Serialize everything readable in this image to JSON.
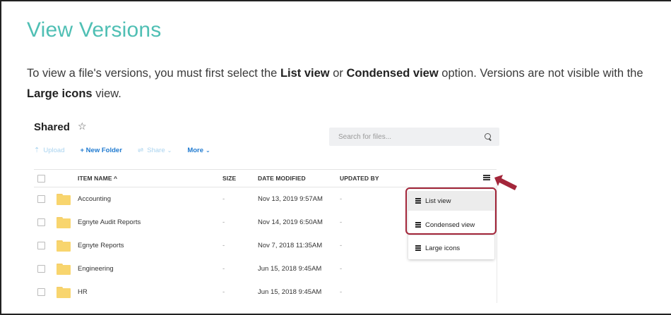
{
  "doc": {
    "title": "View Versions",
    "para_1": "To view a file's versions, you must first select the ",
    "para_bold_1": "List view",
    "para_2": " or ",
    "para_bold_2": "Condensed view",
    "para_3": " option. Versions are not visible with the ",
    "para_bold_3": "Large icons",
    "para_4": " view."
  },
  "app": {
    "folder_title": "Shared",
    "star_icon": "star-outline-icon",
    "toolbar": {
      "upload": "Upload",
      "new_folder": "+ New Folder",
      "share": "Share",
      "more": "More"
    },
    "search": {
      "placeholder": "Search for files..."
    },
    "table": {
      "headers": {
        "name": "ITEM NAME ^",
        "size": "SIZE",
        "date": "DATE MODIFIED",
        "updated_by": "UPDATED BY"
      },
      "rows": [
        {
          "name": "Accounting",
          "size": "-",
          "date": "Nov 13, 2019 9:57AM",
          "updated_by": "-"
        },
        {
          "name": "Egnyte Audit Reports",
          "size": "-",
          "date": "Nov 14, 2019 6:50AM",
          "updated_by": "-"
        },
        {
          "name": "Egnyte Reports",
          "size": "-",
          "date": "Nov 7, 2018 11:35AM",
          "updated_by": "-"
        },
        {
          "name": "Engineering",
          "size": "-",
          "date": "Jun 15, 2018 9:45AM",
          "updated_by": "-"
        },
        {
          "name": "HR",
          "size": "-",
          "date": "Jun 15, 2018 9:45AM",
          "updated_by": "-"
        }
      ]
    },
    "view_menu": {
      "list_view": "List view",
      "condensed_view": "Condensed view",
      "large_icons": "Large icons"
    },
    "colors": {
      "title_teal": "#4fbfb4",
      "link_blue": "#1f7ad0",
      "highlight_red": "#a3263a",
      "folder_yellow": "#f8d56e"
    }
  }
}
